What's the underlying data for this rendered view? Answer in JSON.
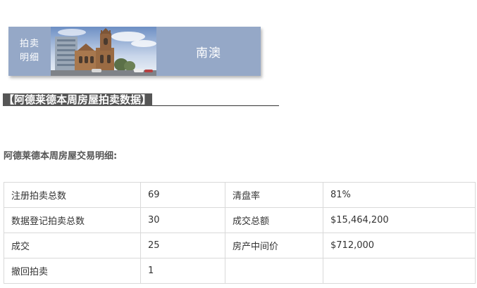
{
  "banner": {
    "tag_line1": "拍卖",
    "tag_line2": "明细",
    "region": "南澳",
    "photo_icon": "city-cathedral-photo"
  },
  "heading": "【阿德莱德本周房屋拍卖数据】",
  "subtitle": "阿德莱德本周房屋交易明细:",
  "table": {
    "rows": [
      [
        "注册拍卖总数",
        "69",
        "清盘率",
        "81%"
      ],
      [
        "数据登记拍卖总数",
        "30",
        "成交总额",
        "$15,464,200"
      ],
      [
        "成交",
        "25",
        "房产中间价",
        "$712,000"
      ],
      [
        "撤回拍卖",
        "1",
        "",
        ""
      ]
    ]
  },
  "colors": {
    "banner_bg": "#95a8c7",
    "heading_bg": "#565656",
    "table_border": "#d9d9d9"
  }
}
